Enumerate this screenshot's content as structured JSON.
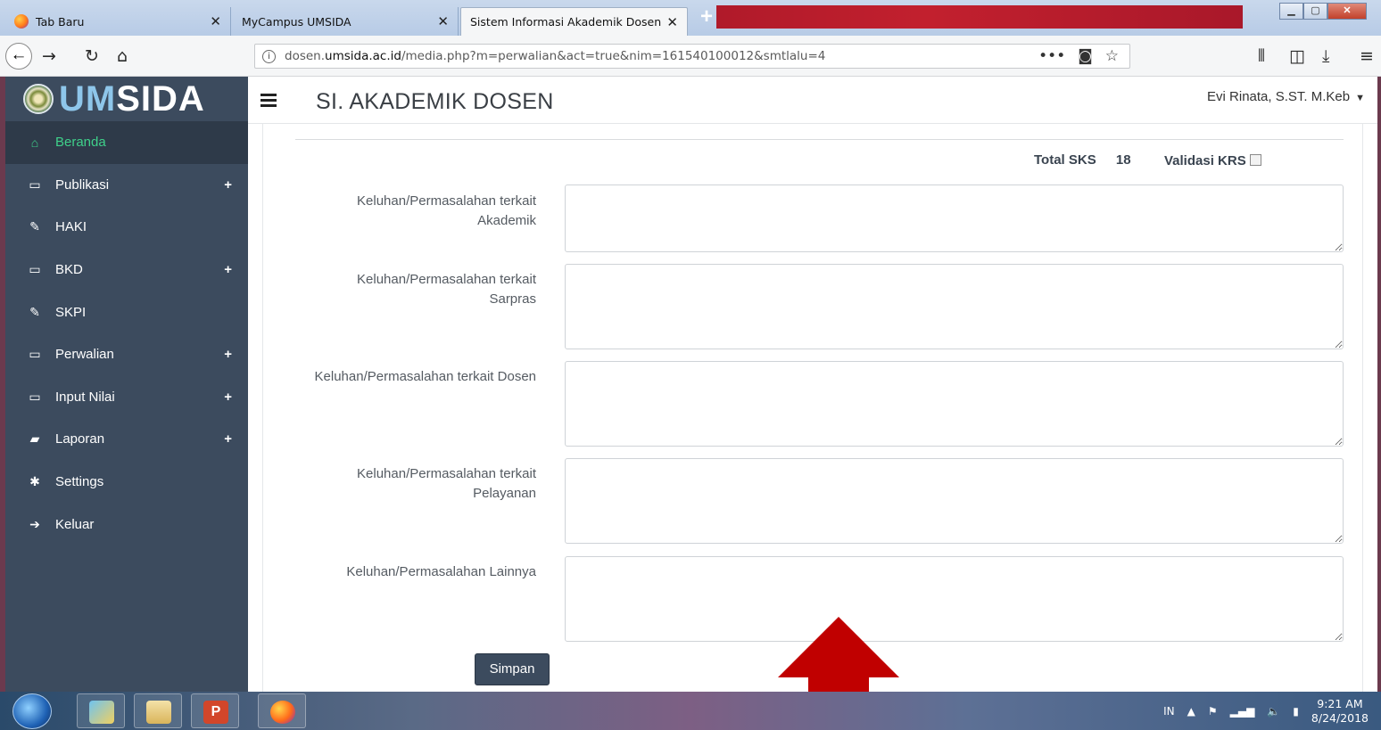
{
  "browser": {
    "tabs": [
      {
        "label": "Tab Baru",
        "active": false
      },
      {
        "label": "MyCampus UMSIDA",
        "active": false
      },
      {
        "label": "Sistem Informasi Akademik Dosen",
        "active": true
      }
    ],
    "close_glyph": "✕",
    "new_tab_glyph": "+",
    "url_prefix": "dosen.",
    "url_domain": "umsida.ac.id",
    "url_path": "/media.php?m=perwalian&act=true&nim=161540100012&smtlalu=4",
    "icons": [
      "back-icon",
      "forward-icon",
      "reload-icon",
      "home-icon",
      "info-icon",
      "more-icon",
      "pocket-icon",
      "bookmark-star-icon",
      "library-icon",
      "sidebar-icon",
      "download-icon",
      "menu-icon"
    ]
  },
  "app": {
    "logo_text_um": "UM",
    "logo_text_sida": "SIDA",
    "title": "SI. AKADEMIK DOSEN",
    "user_name": "Evi Rinata, S.ST. M.Keb"
  },
  "sidebar": {
    "items": [
      {
        "label": "Beranda",
        "icon": "home-icon",
        "glyph": "⌂",
        "expandable": false,
        "active": true
      },
      {
        "label": "Publikasi",
        "icon": "laptop-icon",
        "glyph": "▭",
        "expandable": true
      },
      {
        "label": "HAKI",
        "icon": "edit-icon",
        "glyph": "✎",
        "expandable": false
      },
      {
        "label": "BKD",
        "icon": "laptop-icon",
        "glyph": "▭",
        "expandable": true
      },
      {
        "label": "SKPI",
        "icon": "edit-icon",
        "glyph": "✎",
        "expandable": false
      },
      {
        "label": "Perwalian",
        "icon": "laptop-icon",
        "glyph": "▭",
        "expandable": true
      },
      {
        "label": "Input Nilai",
        "icon": "laptop-icon",
        "glyph": "▭",
        "expandable": true
      },
      {
        "label": "Laporan",
        "icon": "book-icon",
        "glyph": "▰",
        "expandable": true
      },
      {
        "label": "Settings",
        "icon": "gear-icon",
        "glyph": "✱",
        "expandable": false
      },
      {
        "label": "Keluar",
        "icon": "sign-out-icon",
        "glyph": "➔",
        "expandable": false
      }
    ],
    "plus_glyph": "+"
  },
  "form": {
    "total_sks_label": "Total SKS",
    "total_sks_value": "18",
    "validasi_label": "Validasi KRS",
    "fields": [
      {
        "label_line1": "Keluhan/Permasalahan terkait",
        "label_line2": "Akademik",
        "value": ""
      },
      {
        "label_line1": "Keluhan/Permasalahan terkait",
        "label_line2": "Sarpras",
        "value": ""
      },
      {
        "label_line1": "Keluhan/Permasalahan terkait Dosen",
        "label_line2": "",
        "value": ""
      },
      {
        "label_line1": "Keluhan/Permasalahan terkait",
        "label_line2": "Pelayanan",
        "value": ""
      },
      {
        "label_line1": "Keluhan/Permasalahan Lainnya",
        "label_line2": "",
        "value": ""
      }
    ],
    "save_label": "Simpan"
  },
  "taskbar": {
    "language": "IN",
    "time": "9:21 AM",
    "date": "8/24/2018",
    "apps": [
      "windows-explorer-icon",
      "file-manager-icon",
      "powerpoint-icon",
      "firefox-icon"
    ]
  },
  "colors": {
    "sidebar_bg": "#3c4b5e",
    "active_green": "#3fd08a",
    "arrow_red": "#c00000"
  }
}
